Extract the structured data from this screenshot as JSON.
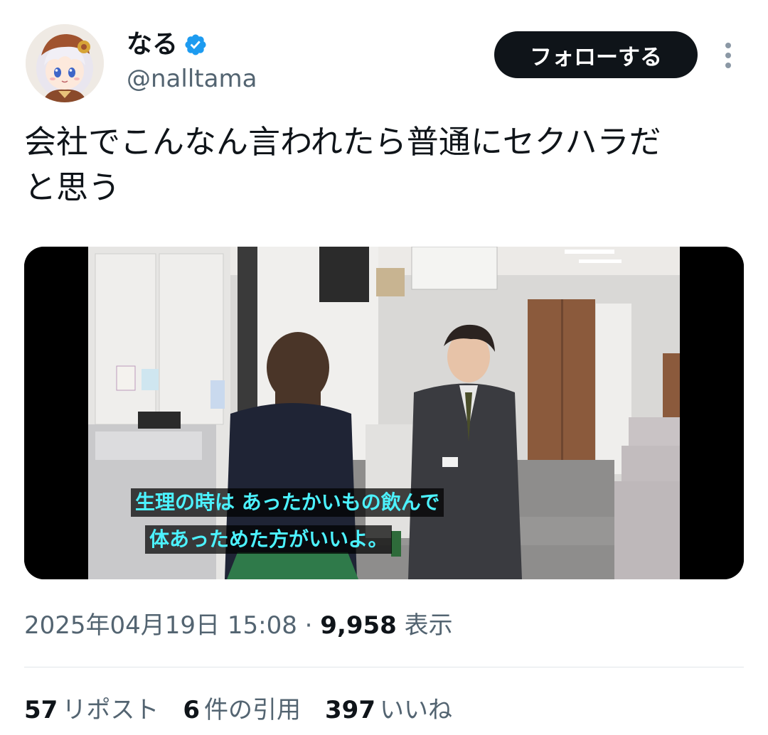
{
  "author": {
    "display_name": "なる",
    "handle": "@nalltama",
    "verified": true,
    "avatar_icon": "anime-girl-avatar"
  },
  "follow_button": {
    "label": "フォローする"
  },
  "more_icon": "more-vertical-icon",
  "tweet": {
    "text": "会社でこんなん言われたら普通にセクハラだ\nと思う"
  },
  "media": {
    "type": "video-frame",
    "subtitle_line1": "生理の時は あったかいもの飲んで",
    "subtitle_line2": "体あっためた方がいいよ。",
    "subtitle_color": "#4cf2ff"
  },
  "meta": {
    "timestamp": "2025年04月19日 15:08",
    "separator": "·",
    "views_count": "9,958",
    "views_label": "表示"
  },
  "stats": [
    {
      "count": "57",
      "label": "リポスト"
    },
    {
      "count": "6",
      "label": "件の引用"
    },
    {
      "count": "397",
      "label": "いいね"
    }
  ],
  "colors": {
    "text_primary": "#0f1419",
    "text_secondary": "#536471",
    "verified_blue": "#1d9bf0",
    "follow_bg": "#0f1419"
  }
}
